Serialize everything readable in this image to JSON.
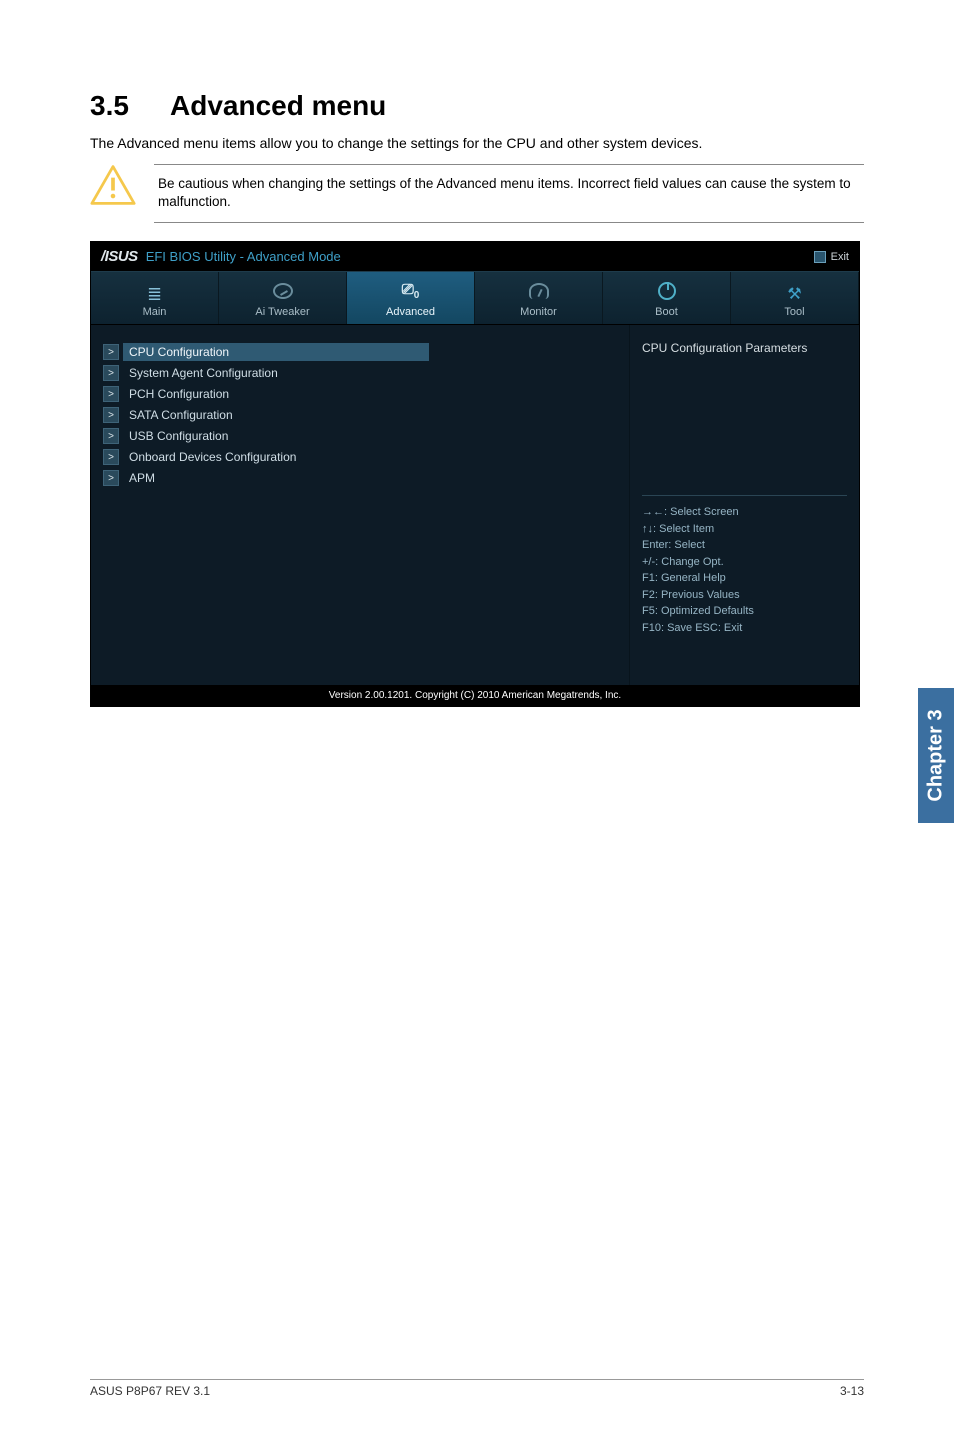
{
  "section": {
    "number": "3.5",
    "title": "Advanced menu"
  },
  "intro": "The Advanced menu items allow you to change the settings for the CPU and other system devices.",
  "caution": "Be cautious when changing the settings of the Advanced menu items. Incorrect field values can cause the system to malfunction.",
  "bios": {
    "logo": "/ISUS",
    "subtitle": "EFI BIOS Utility - Advanced Mode",
    "exit": "Exit",
    "tabs": [
      {
        "label": "Main"
      },
      {
        "label": "Ai Tweaker"
      },
      {
        "label": "Advanced"
      },
      {
        "label": "Monitor"
      },
      {
        "label": "Boot"
      },
      {
        "label": "Tool"
      }
    ],
    "menu": [
      {
        "label": "CPU Configuration",
        "selected": true
      },
      {
        "label": "System Agent Configuration"
      },
      {
        "label": "PCH Configuration"
      },
      {
        "label": "SATA Configuration"
      },
      {
        "label": "USB Configuration"
      },
      {
        "label": "Onboard Devices Configuration"
      },
      {
        "label": "APM"
      }
    ],
    "right_title": "CPU Configuration Parameters",
    "help": [
      "→←: Select Screen",
      "↑↓: Select Item",
      "Enter: Select",
      "+/-: Change Opt.",
      "F1: General Help",
      "F2: Previous Values",
      "F5: Optimized Defaults",
      "F10: Save   ESC: Exit"
    ],
    "footer": "Version 2.00.1201.  Copyright (C) 2010 American Megatrends, Inc."
  },
  "side_tab": "Chapter 3",
  "footer": {
    "left": "ASUS P8P67 REV 3.1",
    "right": "3-13"
  }
}
